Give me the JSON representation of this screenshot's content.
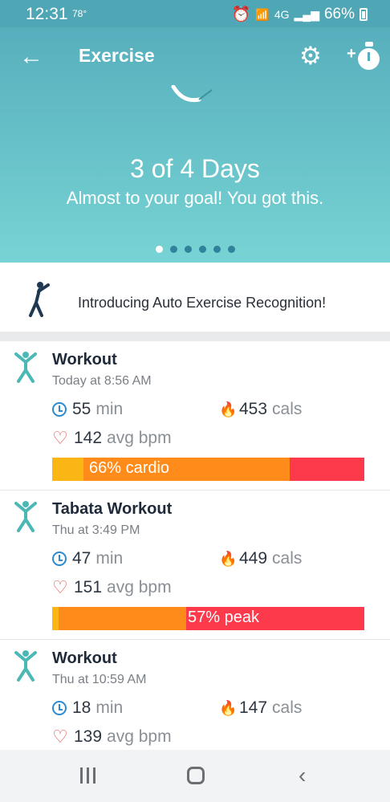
{
  "status": {
    "time": "12:31",
    "temp": "78°",
    "network": "4G",
    "battery": "66%"
  },
  "header": {
    "title": "Exercise"
  },
  "hero": {
    "heading": "3 of 4 Days",
    "subtitle": "Almost to your goal! You got this.",
    "page_index": 0,
    "page_count": 6
  },
  "promo": {
    "text": "Introducing Auto Exercise Recognition!"
  },
  "workouts": [
    {
      "title": "Workout",
      "time": "Today at 8:56 AM",
      "duration": "55",
      "duration_unit": "min",
      "calories": "453",
      "calories_unit": "cals",
      "bpm": "142",
      "bpm_unit": "avg bpm",
      "zone_label": "66% cardio",
      "zones": {
        "fat": 10,
        "cardio": 66,
        "peak": 24
      }
    },
    {
      "title": "Tabata Workout",
      "time": "Thu at 3:49 PM",
      "duration": "47",
      "duration_unit": "min",
      "calories": "449",
      "calories_unit": "cals",
      "bpm": "151",
      "bpm_unit": "avg bpm",
      "zone_label": "57% peak",
      "zones": {
        "fat": 2,
        "cardio": 41,
        "peak": 57
      }
    },
    {
      "title": "Workout",
      "time": "Thu at 10:59 AM",
      "duration": "18",
      "duration_unit": "min",
      "calories": "147",
      "calories_unit": "cals",
      "bpm": "139",
      "bpm_unit": "avg bpm"
    }
  ],
  "colors": {
    "header": "#57afbd",
    "fat_burn": "#fbb515",
    "cardio": "#ff8c1a",
    "peak": "#fd3a4c",
    "accent": "#4cb8b6"
  }
}
